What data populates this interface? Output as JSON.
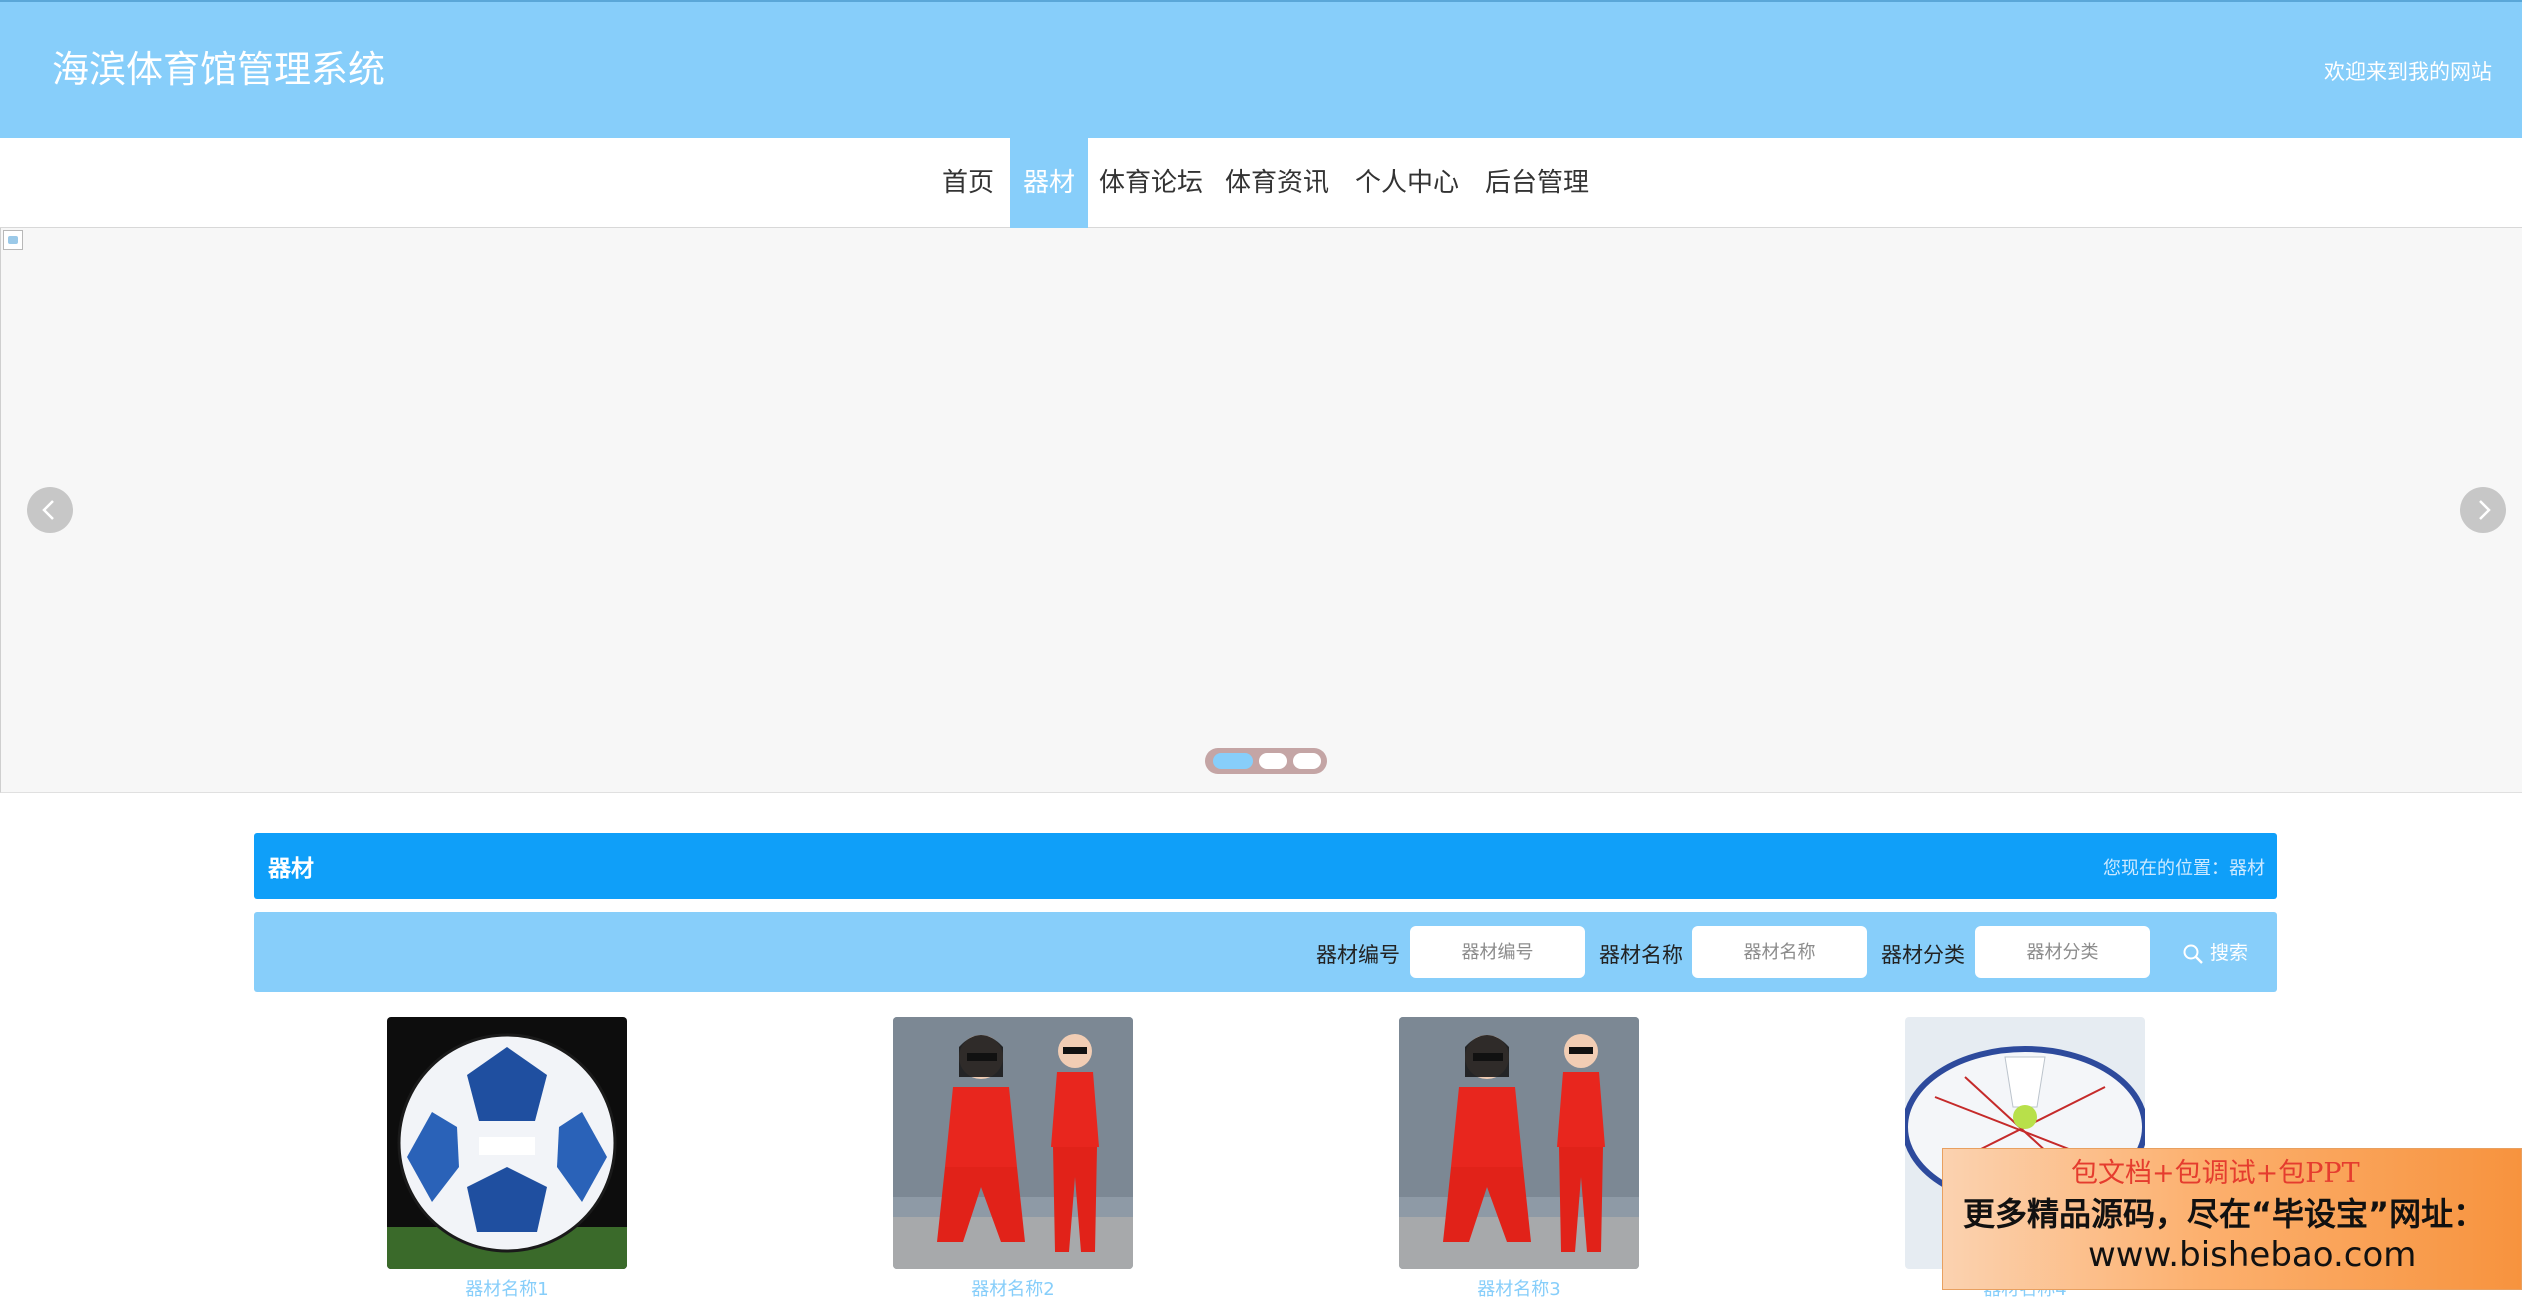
{
  "header": {
    "site_title": "海滨体育馆管理系统",
    "welcome": "欢迎来到我的网站"
  },
  "nav": {
    "items": [
      "首页",
      "器材",
      "体育论坛",
      "体育资讯",
      "个人中心",
      "后台管理"
    ],
    "active": "器材"
  },
  "banner": {
    "prev_icon": "chevron-left-icon",
    "next_icon": "chevron-right-icon",
    "slide_count": 3,
    "active_slide": 1
  },
  "section": {
    "title": "器材",
    "location": "您现在的位置：器材"
  },
  "search": {
    "code_label": "器材编号",
    "code_placeholder": "器材编号",
    "name_label": "器材名称",
    "name_placeholder": "器材名称",
    "category_label": "器材分类",
    "category_placeholder": "器材分类",
    "button_label": "搜索",
    "button_icon": "search-icon"
  },
  "products": [
    {
      "name": "器材名称1",
      "image": "soccer-ball"
    },
    {
      "name": "器材名称2",
      "image": "red-tracksuit"
    },
    {
      "name": "器材名称3",
      "image": "red-tracksuit"
    },
    {
      "name": "器材名称4",
      "image": "badminton-racket-shuttlecock"
    }
  ],
  "ad": {
    "line1": "包文档+包调试+包PPT",
    "line2": "更多精品源码，尽在“毕设宝”网址：",
    "line3": "www.bishebao.com"
  },
  "colors": {
    "primary": "#87cefa",
    "section_header": "#0f9ff9"
  }
}
